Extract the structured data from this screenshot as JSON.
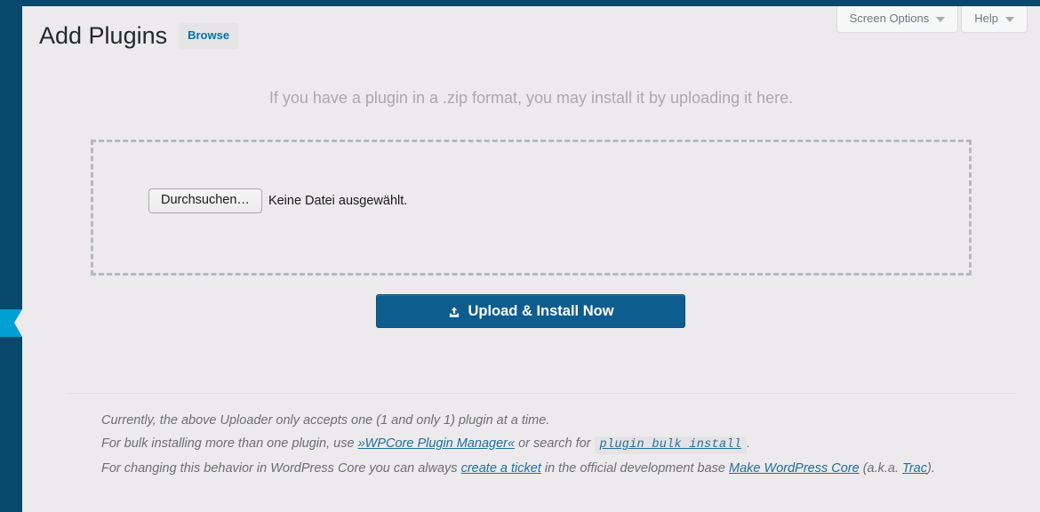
{
  "theme": {
    "admin_blue": "#07486c",
    "highlight_cyan": "#00a0d2",
    "link_blue": "#0073aa",
    "button_blue": "#0e5d8f",
    "page_bg": "#eceaed"
  },
  "screen_meta": {
    "screen_options_label": "Screen Options",
    "help_label": "Help"
  },
  "header": {
    "page_title": "Add Plugins",
    "browse_tab_label": "Browse"
  },
  "upload": {
    "help_text": "If you have a plugin in a .zip format, you may install it by uploading it here.",
    "file_browse_label": "Durchsuchen…",
    "file_status_text": "Keine Datei ausgewählt.",
    "submit_label": "Upload & Install Now",
    "submit_icon": "upload-icon"
  },
  "notes": {
    "line1": "Currently, the above Uploader only accepts one (1 and only 1) plugin at a time.",
    "line2": {
      "prefix": "For bulk installing more than one plugin, use ",
      "link1": "»WPCore Plugin Manager«",
      "middle": " or search for ",
      "code_link": "plugin bulk install",
      "suffix": "."
    },
    "line3": {
      "prefix": "For changing this behavior in WordPress Core you can always ",
      "link1": "create a ticket",
      "middle": " in the official development base ",
      "link2": "Make WordPress Core",
      "middle2": " (a.k.a. ",
      "link3": "Trac",
      "suffix": ")."
    }
  }
}
